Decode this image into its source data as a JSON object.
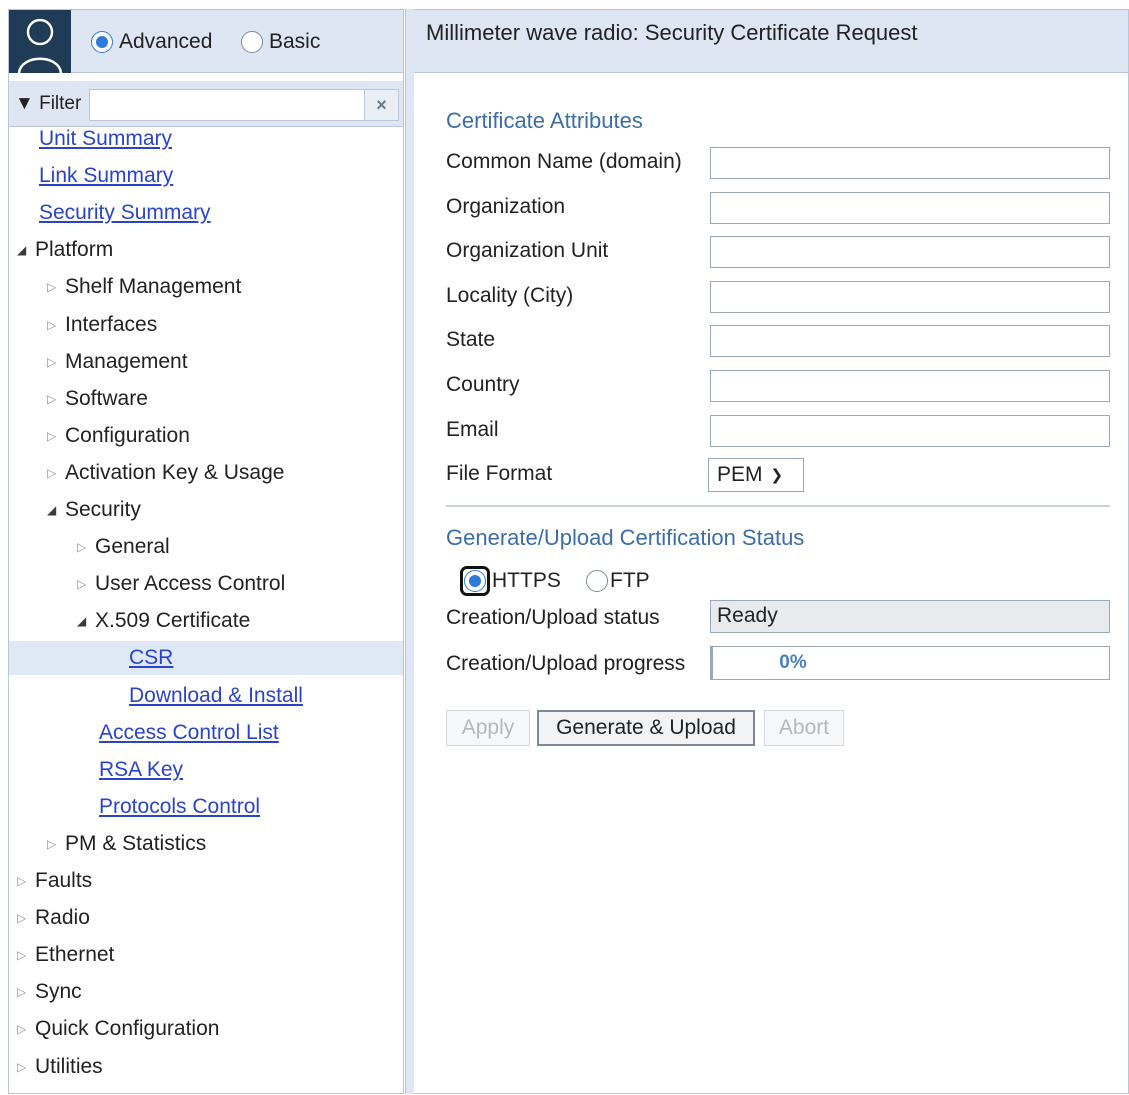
{
  "mode": {
    "options": [
      "Advanced",
      "Basic"
    ],
    "selected": "Advanced"
  },
  "filter": {
    "label": "Filter",
    "value": "",
    "clear_icon": "×"
  },
  "tree": [
    {
      "label": "Unit Summary",
      "level": 0,
      "kind": "link"
    },
    {
      "label": "Link Summary",
      "level": 0,
      "kind": "link"
    },
    {
      "label": "Security Summary",
      "level": 0,
      "kind": "link"
    },
    {
      "label": "Platform",
      "level": 0,
      "kind": "branch",
      "expanded": true
    },
    {
      "label": "Shelf Management",
      "level": 1,
      "kind": "branch",
      "expanded": false
    },
    {
      "label": "Interfaces",
      "level": 1,
      "kind": "branch",
      "expanded": false
    },
    {
      "label": "Management",
      "level": 1,
      "kind": "branch",
      "expanded": false
    },
    {
      "label": "Software",
      "level": 1,
      "kind": "branch",
      "expanded": false
    },
    {
      "label": "Configuration",
      "level": 1,
      "kind": "branch",
      "expanded": false
    },
    {
      "label": "Activation Key & Usage",
      "level": 1,
      "kind": "branch",
      "expanded": false
    },
    {
      "label": "Security",
      "level": 1,
      "kind": "branch",
      "expanded": true
    },
    {
      "label": "General",
      "level": 2,
      "kind": "branch",
      "expanded": false
    },
    {
      "label": "User Access Control",
      "level": 2,
      "kind": "branch",
      "expanded": false
    },
    {
      "label": "X.509 Certificate",
      "level": 2,
      "kind": "branch",
      "expanded": true
    },
    {
      "label": "CSR",
      "level": 3,
      "kind": "link",
      "selected": true
    },
    {
      "label": "Download & Install",
      "level": 3,
      "kind": "link"
    },
    {
      "label": "Access Control List",
      "level": 2,
      "kind": "link"
    },
    {
      "label": "RSA Key",
      "level": 2,
      "kind": "link"
    },
    {
      "label": "Protocols Control",
      "level": 2,
      "kind": "link"
    },
    {
      "label": "PM & Statistics",
      "level": 1,
      "kind": "branch",
      "expanded": false
    },
    {
      "label": "Faults",
      "level": 0,
      "kind": "branch",
      "expanded": false
    },
    {
      "label": "Radio",
      "level": 0,
      "kind": "branch",
      "expanded": false
    },
    {
      "label": "Ethernet",
      "level": 0,
      "kind": "branch",
      "expanded": false
    },
    {
      "label": "Sync",
      "level": 0,
      "kind": "branch",
      "expanded": false
    },
    {
      "label": "Quick Configuration",
      "level": 0,
      "kind": "branch",
      "expanded": false
    },
    {
      "label": "Utilities",
      "level": 0,
      "kind": "branch",
      "expanded": false
    }
  ],
  "page": {
    "title": "Millimeter wave radio: Security Certificate Request"
  },
  "attributes": {
    "section_title": "Certificate Attributes",
    "fields": [
      {
        "label": "Common Name (domain)",
        "value": ""
      },
      {
        "label": "Organization",
        "value": ""
      },
      {
        "label": "Organization Unit",
        "value": ""
      },
      {
        "label": "Locality (City)",
        "value": ""
      },
      {
        "label": "State",
        "value": ""
      },
      {
        "label": "Country",
        "value": ""
      },
      {
        "label": "Email",
        "value": ""
      }
    ],
    "file_format": {
      "label": "File Format",
      "value": "PEM"
    }
  },
  "status": {
    "section_title": "Generate/Upload Certification Status",
    "protocols": [
      "HTTPS",
      "FTP"
    ],
    "selected_protocol": "HTTPS",
    "creation_label": "Creation/Upload status",
    "creation_value": "Ready",
    "progress_label": "Creation/Upload progress",
    "progress_text": "0%",
    "progress_percent": 0
  },
  "buttons": {
    "apply": "Apply",
    "generate": "Generate & Upload",
    "abort": "Abort"
  },
  "colors": {
    "header_bg": "#dde6f2",
    "link": "#2a44c9",
    "section_title": "#3c6ea6",
    "accent": "#2f7ad9",
    "avatar_bg": "#1f3b55"
  }
}
